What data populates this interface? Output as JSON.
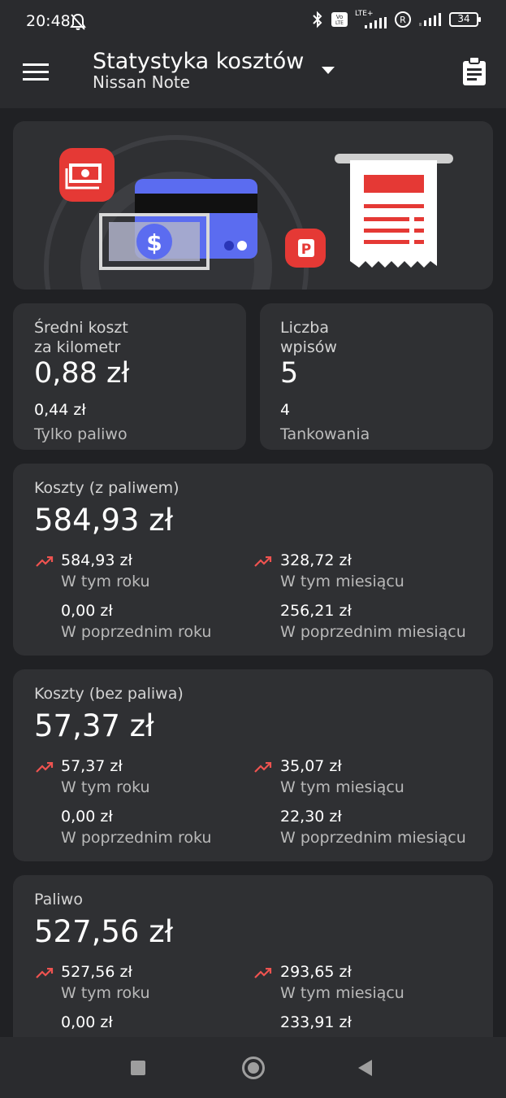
{
  "status_bar": {
    "time": "20:48",
    "lte_label": "LTE+",
    "volte_label": "Vo LTE",
    "battery": "34"
  },
  "app_bar": {
    "title": "Statystyka kosztów",
    "subtitle": "Nissan Note"
  },
  "avg_cost_card": {
    "label_line1": "Średni koszt",
    "label_line2": "za kilometr",
    "value": "0,88 zł",
    "sub_value": "0,44 zł",
    "sub_label": "Tylko paliwo"
  },
  "entries_card": {
    "label_line1": "Liczba",
    "label_line2": "wpisów",
    "value": "5",
    "sub_value": "4",
    "sub_label": "Tankowania"
  },
  "cost_cards": [
    {
      "title": "Koszty (z paliwem)",
      "total": "584,93 zł",
      "this_year_value": "584,93 zł",
      "this_year_label": "W tym roku",
      "prev_year_value": "0,00 zł",
      "prev_year_label": "W poprzednim roku",
      "this_month_value": "328,72 zł",
      "this_month_label": "W tym miesiącu",
      "prev_month_value": "256,21 zł",
      "prev_month_label": "W poprzednim miesiącu"
    },
    {
      "title": "Koszty (bez paliwa)",
      "total": "57,37 zł",
      "this_year_value": "57,37 zł",
      "this_year_label": "W tym roku",
      "prev_year_value": "0,00 zł",
      "prev_year_label": "W poprzednim roku",
      "this_month_value": "35,07 zł",
      "this_month_label": "W tym miesiącu",
      "prev_month_value": "22,30 zł",
      "prev_month_label": "W poprzednim miesiącu"
    },
    {
      "title": "Paliwo",
      "total": "527,56 zł",
      "this_year_value": "527,56 zł",
      "this_year_label": "W tym roku",
      "prev_year_value": "0,00 zł",
      "this_month_value": "293,65 zł",
      "this_month_label": "W tym miesiącu",
      "prev_month_value": "233,91 zł"
    }
  ],
  "colors": {
    "accent_red": "#e53935",
    "trend_red": "#ef5350",
    "card_bg": "#2f3033",
    "page_bg": "#202124",
    "bar_bg": "#2a2b2e",
    "card_blue": "#5b6cf0"
  },
  "icons": {
    "menu": "hamburger-menu-icon",
    "dropdown": "dropdown-arrow-icon",
    "clipboard": "clipboard-icon",
    "trend": "trending-up-icon"
  }
}
